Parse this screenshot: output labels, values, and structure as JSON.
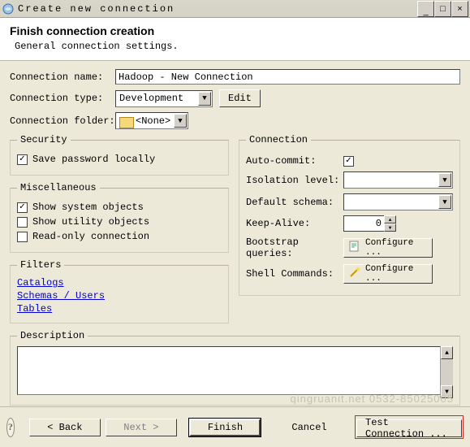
{
  "window": {
    "title": "Create new connection",
    "minimize": "_",
    "maximize": "□",
    "close": "×"
  },
  "header": {
    "title": "Finish connection creation",
    "subtitle": "General connection settings."
  },
  "fields": {
    "name_label": "Connection name:",
    "name_value": "Hadoop - New Connection",
    "type_label": "Connection type:",
    "type_value": "Development",
    "edit_btn": "Edit",
    "folder_label": "Connection folder:",
    "folder_value": "<None>"
  },
  "security": {
    "legend": "Security",
    "save_pw": "Save password locally",
    "save_pw_checked": "✓"
  },
  "misc": {
    "legend": "Miscellaneous",
    "show_system": "Show system objects",
    "show_system_checked": "✓",
    "show_utility": "Show utility objects",
    "readonly": "Read-only connection"
  },
  "filters": {
    "legend": "Filters",
    "catalogs": "Catalogs",
    "schemas": "Schemas / Users",
    "tables": "Tables"
  },
  "connection": {
    "legend": "Connection",
    "autocommit_label": "Auto-commit:",
    "autocommit_checked": "✓",
    "isolation_label": "Isolation level:",
    "isolation_value": "",
    "schema_label": "Default schema:",
    "schema_value": "",
    "keepalive_label": "Keep-Alive:",
    "keepalive_value": "0",
    "bootstrap_label": "Bootstrap queries:",
    "shell_label": "Shell Commands:",
    "configure_btn": "Configure ..."
  },
  "description": {
    "legend": "Description",
    "value": ""
  },
  "footer": {
    "help": "?",
    "back": "< Back",
    "next": "Next >",
    "finish": "Finish",
    "cancel": "Cancel",
    "test": "Test Connection ..."
  },
  "watermark": "qingruanit.net 0532-85025005"
}
